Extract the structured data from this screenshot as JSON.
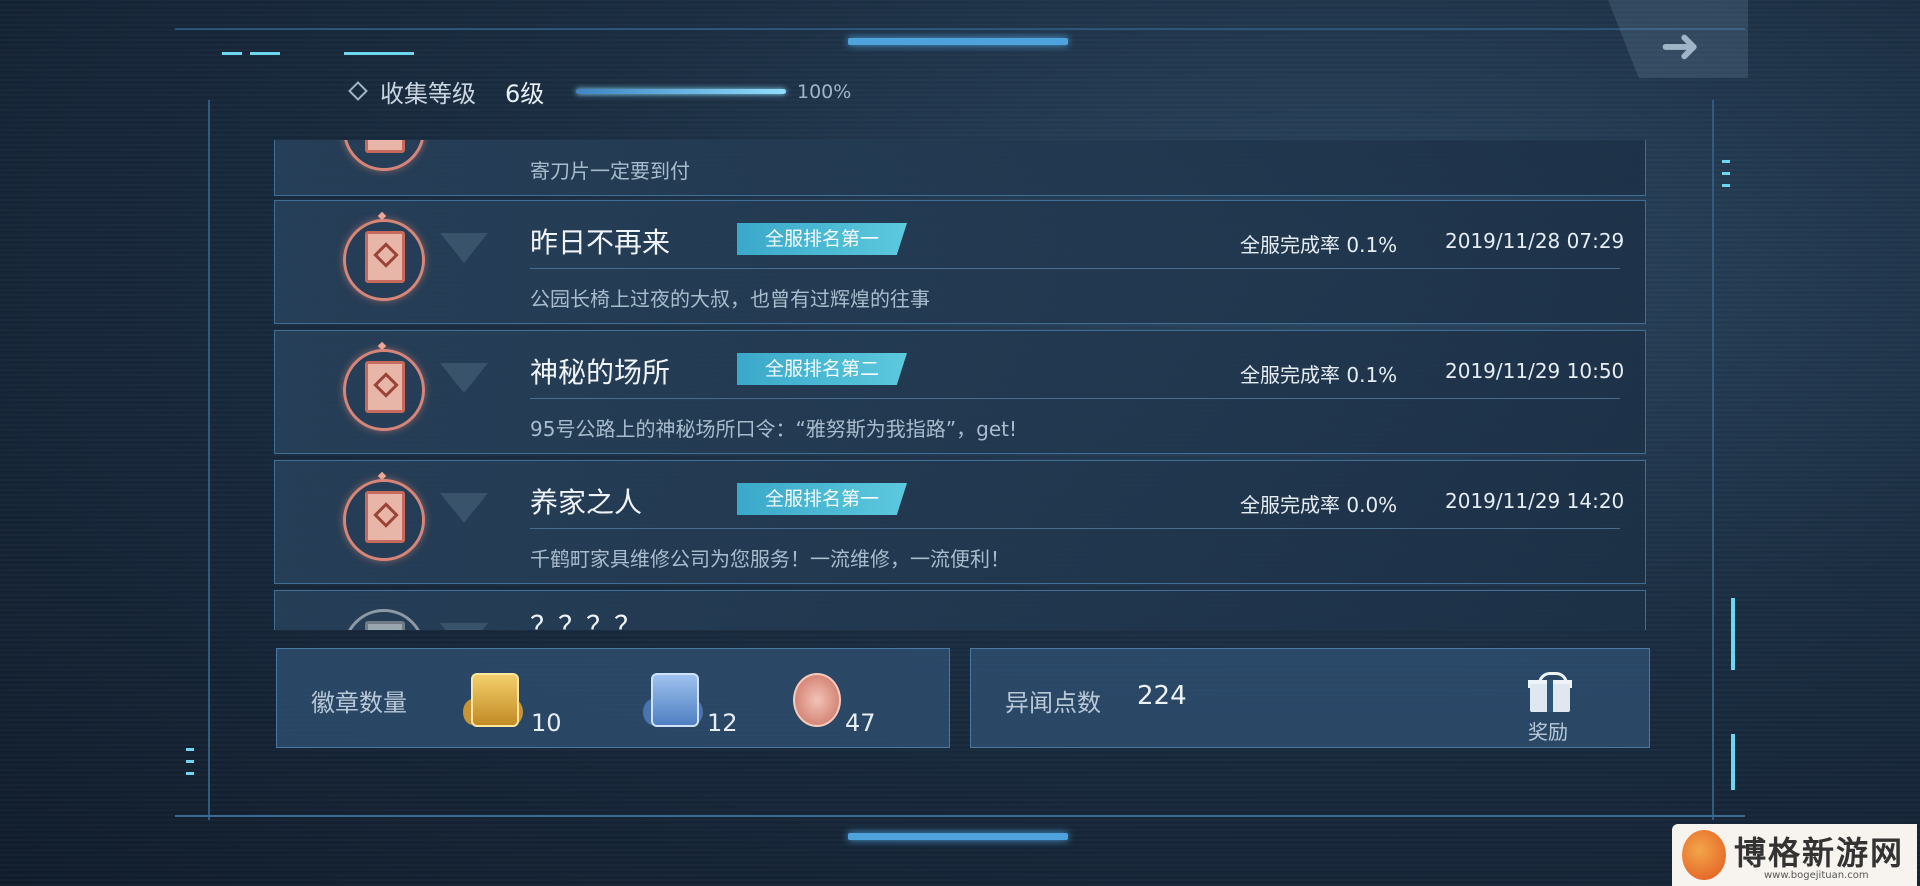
{
  "header": {
    "label": "收集等级",
    "level": "6级",
    "progress": 1.0,
    "progress_text": "100%"
  },
  "list": {
    "partial_top_desc": "寄刀片一定要到付",
    "rows": [
      {
        "name": "昨日不再来",
        "tag": "全服排名第一",
        "rate": "全服完成率 0.1%",
        "time": "2019/11/28 07:29",
        "desc": "公园长椅上过夜的大叔，也曾有过辉煌的往事"
      },
      {
        "name": "神秘的场所",
        "tag": "全服排名第二",
        "rate": "全服完成率 0.1%",
        "time": "2019/11/29 10:50",
        "desc": "95号公路上的神秘场所口令：“雅努斯为我指路”，get!"
      },
      {
        "name": "养家之人",
        "tag": "全服排名第一",
        "rate": "全服完成率 0.0%",
        "time": "2019/11/29 14:20",
        "desc": "千鹤町家具维修公司为您服务！一流维修，一流便利！"
      }
    ],
    "partial_bottom_name": "？？？？"
  },
  "badges_panel": {
    "label": "徽章数量",
    "gold_count": "10",
    "blue_count": "12",
    "red_count": "47"
  },
  "points_panel": {
    "label": "异闻点数",
    "value": "224",
    "reward_label": "奖励"
  },
  "watermark": {
    "title": "博格新游网",
    "url": "www.bogejituan.com"
  },
  "colors": {
    "accent": "#4fa3dd",
    "tag_bg": "#3aa8c9",
    "gold_badge": "#d9a53a",
    "blue_badge": "#5f8fd0",
    "red_badge": "#d88579"
  }
}
